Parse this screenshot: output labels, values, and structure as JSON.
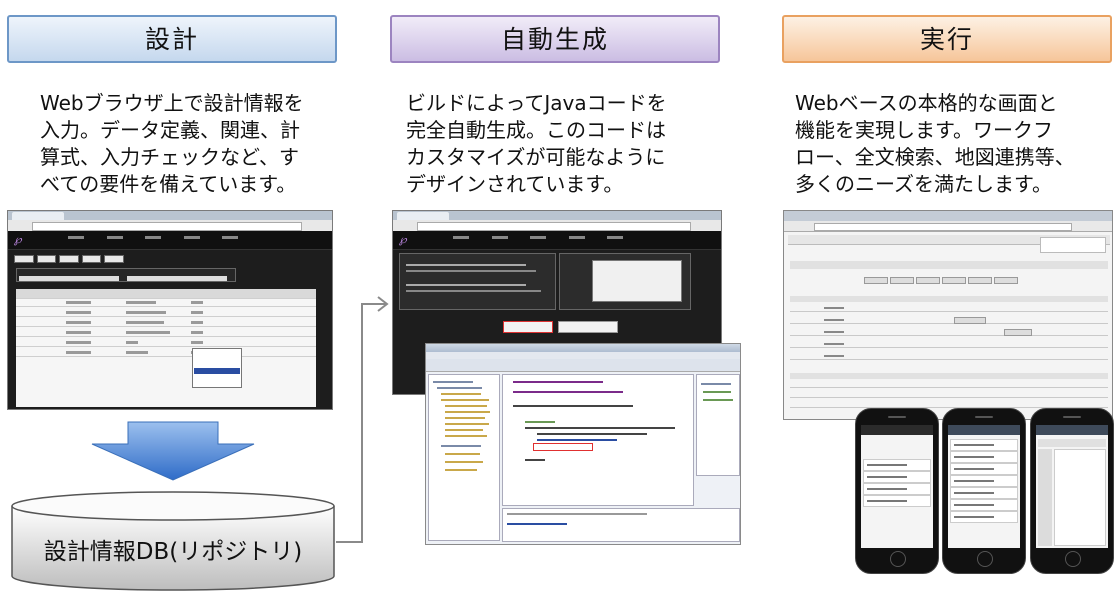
{
  "design": {
    "title": "設計",
    "desc": [
      "Webブラウザ上で設計情報を",
      "入力。データ定義、関連、計",
      "算式、入力チェックなど、す",
      "べての要件を備えています。"
    ]
  },
  "generate": {
    "title": "自動生成",
    "desc": [
      "ビルドによってJavaコードを",
      "完全自動生成。このコードは",
      "カスタマイズが可能なように",
      "デザインされています。"
    ]
  },
  "execute": {
    "title": "実行",
    "desc": [
      "Webベースの本格的な画面と",
      "機能を実現します。ワークフ",
      "ロー、全文検索、地図連携等、",
      "多くのニーズを満たします。"
    ]
  },
  "database": {
    "label": "設計情報DB(リポジトリ)"
  },
  "colors": {
    "design_header": "#c5d8ee",
    "generate_header": "#cbbde3",
    "execute_header": "#f6c69a",
    "down_arrow": "#3f7bd0",
    "connector": "#8a8a8a"
  }
}
